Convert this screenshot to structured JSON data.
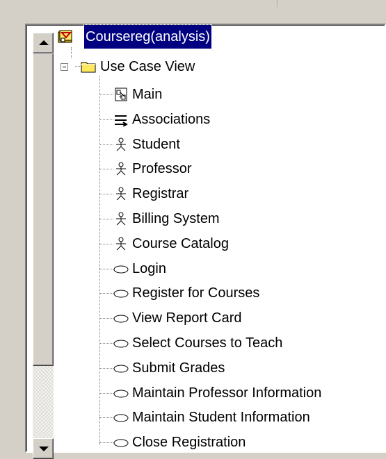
{
  "root": {
    "label": "Coursereg(analysis)",
    "icon": "model-icon",
    "selected": true
  },
  "folder": {
    "label": "Use Case View",
    "icon": "folder-icon",
    "expanded": true
  },
  "items": [
    {
      "label": "Main",
      "icon": "diagram-icon"
    },
    {
      "label": "Associations",
      "icon": "associations-icon"
    },
    {
      "label": "Student",
      "icon": "actor-icon"
    },
    {
      "label": "Professor",
      "icon": "actor-icon"
    },
    {
      "label": "Registrar",
      "icon": "actor-icon"
    },
    {
      "label": "Billing System",
      "icon": "actor-icon"
    },
    {
      "label": "Course Catalog",
      "icon": "actor-icon"
    },
    {
      "label": "Login",
      "icon": "use-case-icon"
    },
    {
      "label": "Register for Courses",
      "icon": "use-case-icon"
    },
    {
      "label": "View Report Card",
      "icon": "use-case-icon"
    },
    {
      "label": "Select Courses to Teach",
      "icon": "use-case-icon"
    },
    {
      "label": "Submit Grades",
      "icon": "use-case-icon"
    },
    {
      "label": "Maintain Professor Information",
      "icon": "use-case-icon"
    },
    {
      "label": "Maintain Student Information",
      "icon": "use-case-icon"
    },
    {
      "label": "Close Registration",
      "icon": "use-case-icon"
    }
  ],
  "scrollbar": {
    "position_fraction": 0.0
  }
}
